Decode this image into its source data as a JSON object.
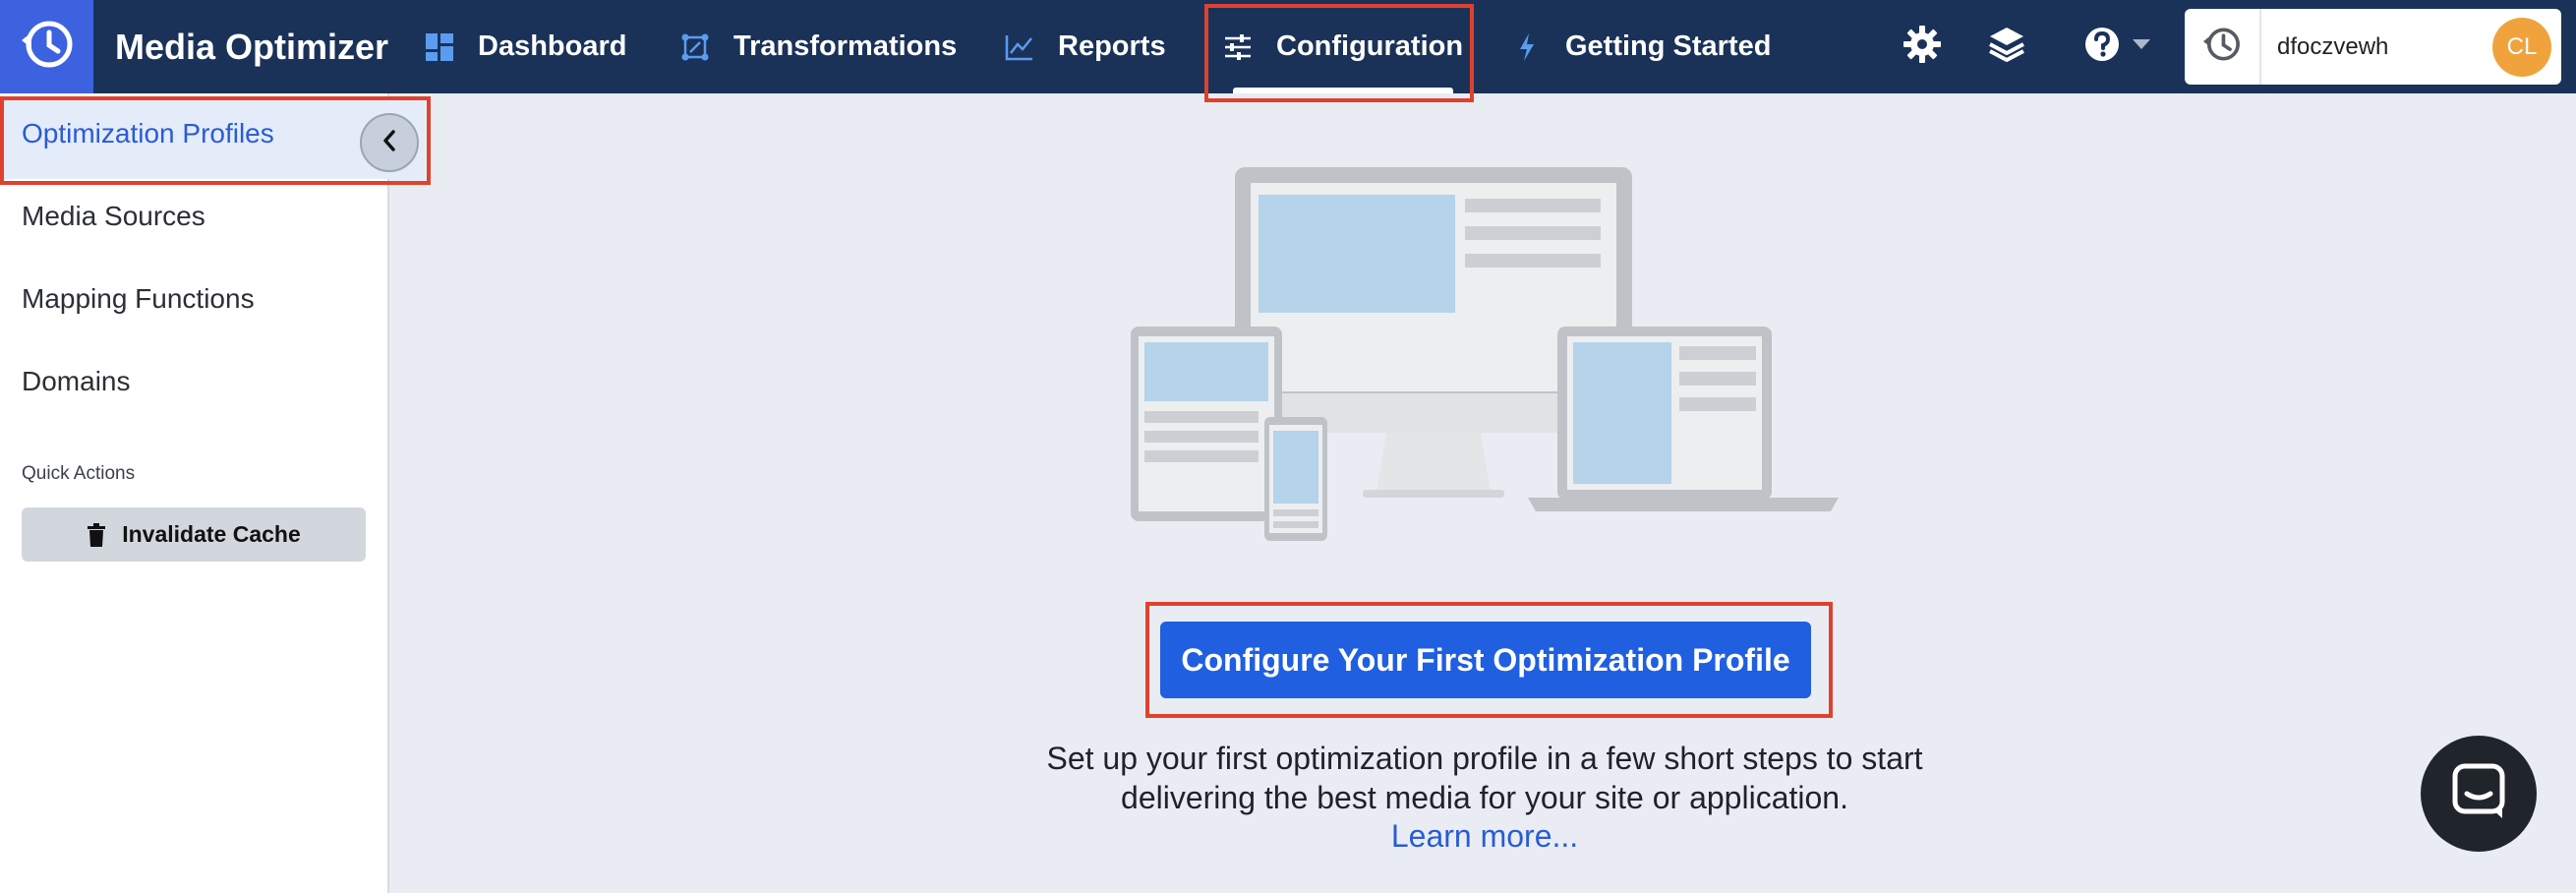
{
  "app": {
    "title": "Media Optimizer",
    "logo_icon": "clock-history-icon"
  },
  "nav": {
    "items": [
      {
        "label": "Dashboard",
        "icon": "dashboard-icon"
      },
      {
        "label": "Transformations",
        "icon": "transform-icon"
      },
      {
        "label": "Reports",
        "icon": "chart-line-icon"
      },
      {
        "label": "Configuration",
        "icon": "sliders-icon",
        "active": true
      },
      {
        "label": "Getting Started",
        "icon": "lightning-icon"
      }
    ]
  },
  "header_actions": {
    "settings_icon": "gear-icon",
    "layers_icon": "layers-icon",
    "help_icon": "help-circle-icon",
    "account": {
      "name": "dfoczvewh",
      "avatar_initials": "CL",
      "avatar_color": "#f0a33c"
    }
  },
  "sidebar": {
    "items": [
      {
        "label": "Optimization Profiles",
        "active": true
      },
      {
        "label": "Media Sources"
      },
      {
        "label": "Mapping Functions"
      },
      {
        "label": "Domains"
      }
    ],
    "quick_actions_label": "Quick Actions",
    "invalidate_cache_label": "Invalidate Cache"
  },
  "main": {
    "cta_label": "Configure Your First Optimization Profile",
    "description_line1": "Set up your first optimization profile in a few short steps to start",
    "description_line2": "delivering the best media for your site or application.",
    "learn_more": "Learn more..."
  },
  "colors": {
    "topbar": "#1a3258",
    "accent": "#1f5fe0",
    "highlight": "#e0412f"
  }
}
